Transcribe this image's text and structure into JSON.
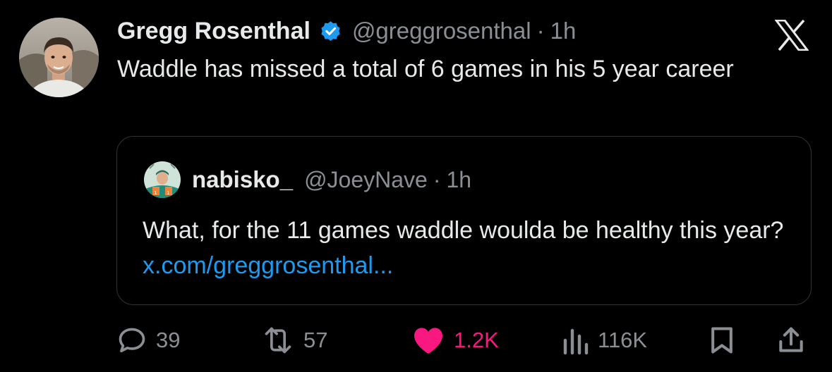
{
  "tweet": {
    "author_name": "Gregg Rosenthal",
    "author_handle": "@greggrosenthal",
    "separator": "·",
    "time": "1h",
    "text": "Waddle has missed a total of 6 games in his 5 year career"
  },
  "quoted_tweet": {
    "author_name": "nabisko_",
    "author_handle": "@JoeyNave",
    "separator": "·",
    "time": "1h",
    "text": "What, for the 11 games waddle woulda be healthy this year?",
    "link_text": "x.com/greggrosenthal..."
  },
  "actions": {
    "replies": "39",
    "reposts": "57",
    "likes": "1.2K",
    "views": "116K"
  },
  "colors": {
    "background": "#000000",
    "text": "#e7e9ea",
    "muted": "#8b8f94",
    "link": "#1d9bf0",
    "like": "#f91880",
    "verified": "#1d9bf0"
  },
  "icons": [
    "x-logo-icon",
    "verified-badge-icon",
    "reply-icon",
    "repost-icon",
    "like-icon",
    "views-icon",
    "bookmark-icon",
    "share-icon"
  ]
}
